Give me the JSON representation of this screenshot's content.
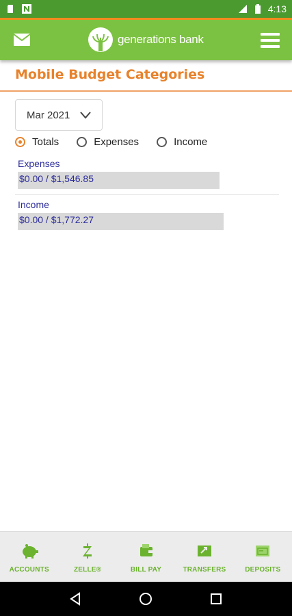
{
  "status_bar": {
    "time": "4:13"
  },
  "header": {
    "logo_text": "generations bank"
  },
  "page": {
    "title": "Mobile Budget Categories"
  },
  "month_select": {
    "value": "Mar 2021"
  },
  "filters": [
    {
      "label": "Totals",
      "checked": true
    },
    {
      "label": "Expenses",
      "checked": false
    },
    {
      "label": "Income",
      "checked": false
    }
  ],
  "categories": [
    {
      "label": "Expenses",
      "amount": "$0.00 / $1,546.85"
    },
    {
      "label": "Income",
      "amount": "$0.00 / $1,772.27"
    }
  ],
  "tabs": [
    {
      "label": "ACCOUNTS",
      "icon": "piggy-bank-icon"
    },
    {
      "label": "ZELLE®",
      "icon": "zelle-icon"
    },
    {
      "label": "BILL PAY",
      "icon": "wallet-icon"
    },
    {
      "label": "TRANSFERS",
      "icon": "transfer-arrows-icon"
    },
    {
      "label": "DEPOSITS",
      "icon": "check-deposit-icon"
    }
  ],
  "colors": {
    "brand_green": "#7cc242",
    "accent_orange": "#e8822b",
    "link_blue": "#2c2c9a"
  }
}
